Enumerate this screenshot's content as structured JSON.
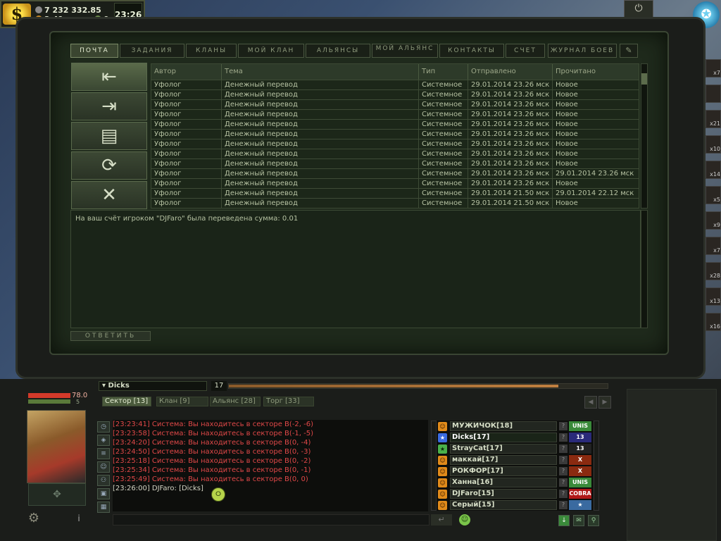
{
  "currency": {
    "coin_symbol": "$",
    "amount": "7 232 332.85",
    "secondary": "2.41",
    "tertiary": "0",
    "clock": "23:26"
  },
  "power_symbol": "⏻",
  "tabs": [
    {
      "label": "ПОЧТА",
      "active": true
    },
    {
      "label": "ЗАДАНИЯ"
    },
    {
      "label": "КЛАНЫ"
    },
    {
      "label": "МОЙ КЛАН"
    },
    {
      "label": "АЛЬЯНСЫ"
    },
    {
      "label": "МОЙ АЛЬЯНС"
    },
    {
      "label": "КОНТАКТЫ"
    },
    {
      "label": "СЧЕТ"
    },
    {
      "label": "ЖУРНАЛ БОЕВ"
    }
  ],
  "mail_actions": [
    {
      "name": "inbox",
      "glyph": "⇤"
    },
    {
      "name": "outbox",
      "glyph": "⇥"
    },
    {
      "name": "new-message",
      "glyph": "▤"
    },
    {
      "name": "refresh",
      "glyph": "⟳"
    },
    {
      "name": "delete",
      "glyph": "✕"
    }
  ],
  "mail_table": {
    "columns": [
      "Автор",
      "Тема",
      "Тип",
      "Отправлено",
      "Прочитано"
    ],
    "rows": [
      [
        "Уфолог",
        "Денежный перевод",
        "Системное",
        "29.01.2014 23.26 мск",
        "Новое"
      ],
      [
        "Уфолог",
        "Денежный перевод",
        "Системное",
        "29.01.2014 23.26 мск",
        "Новое"
      ],
      [
        "Уфолог",
        "Денежный перевод",
        "Системное",
        "29.01.2014 23.26 мск",
        "Новое"
      ],
      [
        "Уфолог",
        "Денежный перевод",
        "Системное",
        "29.01.2014 23.26 мск",
        "Новое"
      ],
      [
        "Уфолог",
        "Денежный перевод",
        "Системное",
        "29.01.2014 23.26 мск",
        "Новое"
      ],
      [
        "Уфолог",
        "Денежный перевод",
        "Системное",
        "29.01.2014 23.26 мск",
        "Новое"
      ],
      [
        "Уфолог",
        "Денежный перевод",
        "Системное",
        "29.01.2014 23.26 мск",
        "Новое"
      ],
      [
        "Уфолог",
        "Денежный перевод",
        "Системное",
        "29.01.2014 23.26 мск",
        "Новое"
      ],
      [
        "Уфолог",
        "Денежный перевод",
        "Системное",
        "29.01.2014 23.26 мск",
        "Новое"
      ],
      [
        "Уфолог",
        "Денежный перевод",
        "Системное",
        "29.01.2014 23.26 мск",
        "29.01.2014 23.26 мск"
      ],
      [
        "Уфолог",
        "Денежный перевод",
        "Системное",
        "29.01.2014 23.26 мск",
        "Новое"
      ],
      [
        "Уфолог",
        "Денежный перевод",
        "Системное",
        "29.01.2014 21.50 мск",
        "29.01.2014 22.12 мск"
      ],
      [
        "Уфолог",
        "Денежный перевод",
        "Системное",
        "29.01.2014 21.50 мск",
        "Новое"
      ]
    ]
  },
  "message_body": "На ваш счёт игроком \"DJFaro\" была переведена сумма: 0.01",
  "reply_label": "ОТВЕТИТЬ",
  "character": {
    "name": "Dicks",
    "hp": "78.0",
    "mp": "5",
    "level": "17",
    "xp_fraction": 0.87
  },
  "chat_channels": [
    {
      "label": "Сектор [13]",
      "active": true
    },
    {
      "label": "Клан [9]"
    },
    {
      "label": "Альянс [28]"
    },
    {
      "label": "Торг [33]"
    }
  ],
  "chat_lines": [
    {
      "text": "[23:23:41] Система: Вы находитесь в секторе B(-2, -6)"
    },
    {
      "text": "[23:23:58] Система: Вы находитесь в секторе B(-1, -5)"
    },
    {
      "text": "[23:24:20] Система: Вы находитесь в секторе B(0, -4)"
    },
    {
      "text": "[23:24:50] Система: Вы находитесь в секторе B(0, -3)"
    },
    {
      "text": "[23:25:18] Система: Вы находитесь в секторе B(0, -2)"
    },
    {
      "text": "[23:25:34] Система: Вы находитесь в секторе B(0, -1)"
    },
    {
      "text": "[23:25:49] Система: Вы находитесь в секторе B(0, 0)"
    },
    {
      "text": "[23:26:00] DJFaro: [Dicks]",
      "own": true
    }
  ],
  "users": [
    {
      "name": "МУЖИЧОК[18]",
      "icon": "orange",
      "clan": "UNIS",
      "clan_color": "#3a8a3a"
    },
    {
      "name": "Dicks[17]",
      "icon": "blue",
      "clan": "13",
      "clan_color": "#2a2a7a",
      "self": true
    },
    {
      "name": "StrayCat[17]",
      "icon": "green",
      "clan": "13",
      "clan_color": "#222222"
    },
    {
      "name": "маккай[17]",
      "icon": "orange",
      "clan": "X",
      "clan_color": "#8a2a10"
    },
    {
      "name": "РОКФОР[17]",
      "icon": "orange",
      "clan": "X",
      "clan_color": "#8a2a10"
    },
    {
      "name": "Ханна[16]",
      "icon": "orange",
      "clan": "UNIS",
      "clan_color": "#3a8a3a"
    },
    {
      "name": "DJFaro[15]",
      "icon": "orange",
      "clan": "COBRA",
      "clan_color": "#b01818"
    },
    {
      "name": "Серый[15]",
      "icon": "orange",
      "clan": "★",
      "clan_color": "#3a6aa0"
    }
  ],
  "inventory_counts": [
    "x7",
    "",
    "x21",
    "x10",
    "x14",
    "x5",
    "x9",
    "x7",
    "x28",
    "x13",
    "x16"
  ]
}
